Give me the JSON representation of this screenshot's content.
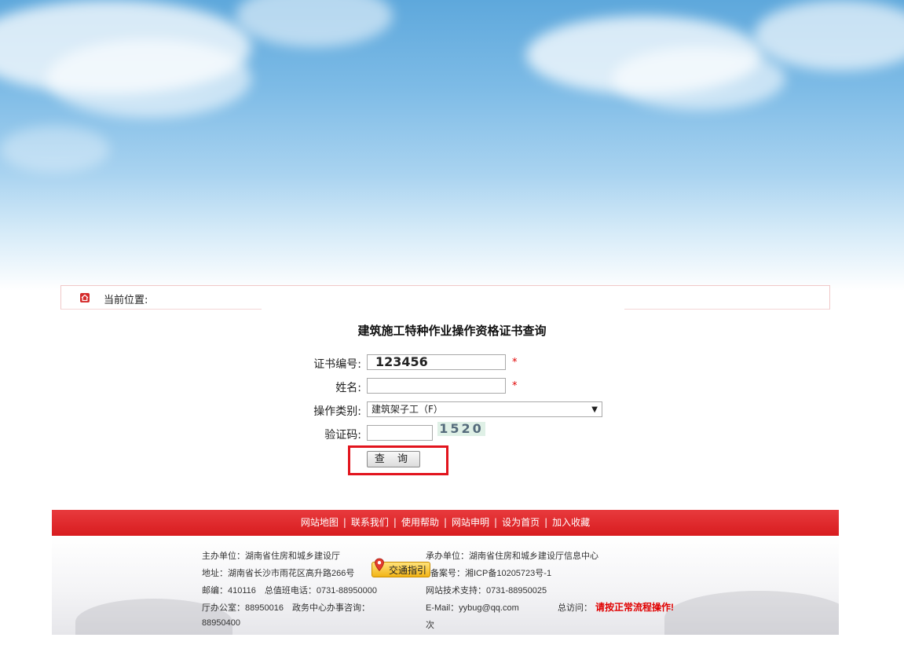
{
  "breadcrumb": {
    "label": "当前位置:"
  },
  "form": {
    "title": "建筑施工特种作业操作资格证书查询",
    "cert_no_label": "证书编号:",
    "cert_no_value": "123456",
    "name_label": "姓名:",
    "name_value": "",
    "category_label": "操作类别:",
    "category_value": "建筑架子工（F）",
    "captcha_label": "验证码:",
    "captcha_value": "",
    "captcha_image_text": "1520",
    "required_mark": "*",
    "submit_label": "查 询"
  },
  "nav": {
    "items": [
      "网站地图",
      "联系我们",
      "使用帮助",
      "网站申明",
      "设为首页",
      "加入收藏"
    ],
    "separator": "|"
  },
  "footer": {
    "sponsor": "主办单位：湖南省住房和城乡建设厅",
    "organizer": "承办单位：湖南省住房和城乡建设厅信息中心",
    "address": "地址：湖南省长沙市雨花区高升路266号",
    "traffic_button": "交通指引",
    "icp": "备案号：湘ICP备10205723号-1",
    "postcode": "邮编：410116　总值班电话：0731-88950000",
    "tech_support": "网站技术支持：0731-88950025",
    "office": "厅办公室：88950016　政务中心办事咨询：",
    "office_phone": "88950400",
    "email": "E-Mail：yybug@qq.com",
    "visits_label": "总访问：",
    "visits_warning": "请按正常流程操作!",
    "visits_unit": "次"
  },
  "colors": {
    "accent_red": "#e2141d",
    "nav_red": "#d81c1f"
  }
}
